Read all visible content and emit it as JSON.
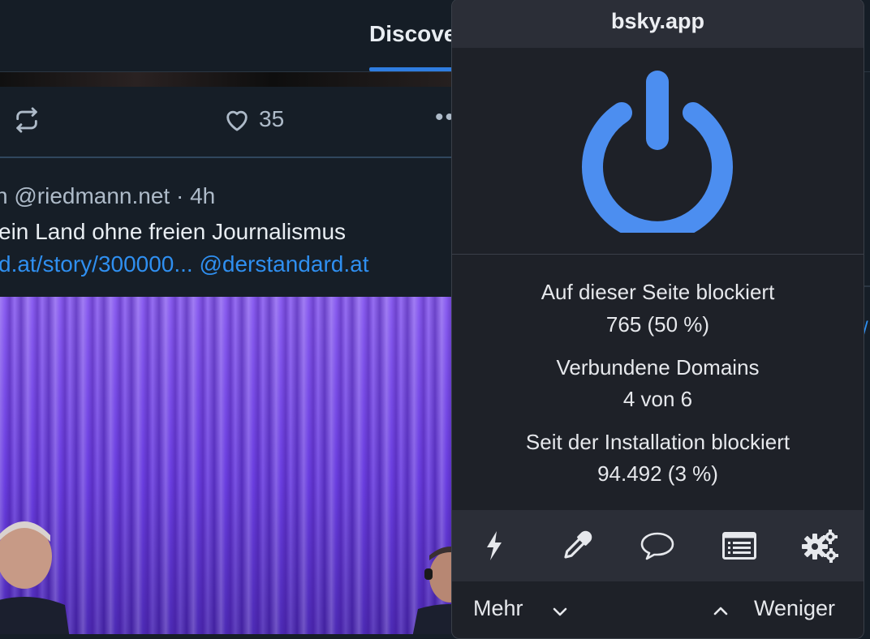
{
  "feed": {
    "tab_label": "Discove",
    "like_count": "35",
    "more_glyph": "••",
    "post_meta": "n @riedmann.net · 4h",
    "post_text": "ein Land ohne freien Journalismus",
    "post_links": "d.at/story/300000... @derstandard.at",
    "right_link_glyph": "/"
  },
  "popup": {
    "domain": "bsky.app",
    "power_color": "#4c8ef0",
    "stats": [
      {
        "label": "Auf dieser Seite blockiert",
        "value": "765 (50 %)"
      },
      {
        "label": "Verbundene Domains",
        "value": "4 von 6"
      },
      {
        "label": "Seit der Installation blockiert",
        "value": "94.492 (3 %)"
      }
    ],
    "tools": [
      {
        "icon": "lightning-icon"
      },
      {
        "icon": "eyedropper-icon"
      },
      {
        "icon": "speech-bubble-icon"
      },
      {
        "icon": "list-icon"
      },
      {
        "icon": "gears-icon"
      }
    ],
    "more_label": "Mehr",
    "less_label": "Weniger"
  },
  "colors": {
    "accent_blue": "#2f7de0",
    "link_blue": "#2f8ff0",
    "popup_bg": "#1e2128",
    "popup_bar": "#2b2e37"
  }
}
